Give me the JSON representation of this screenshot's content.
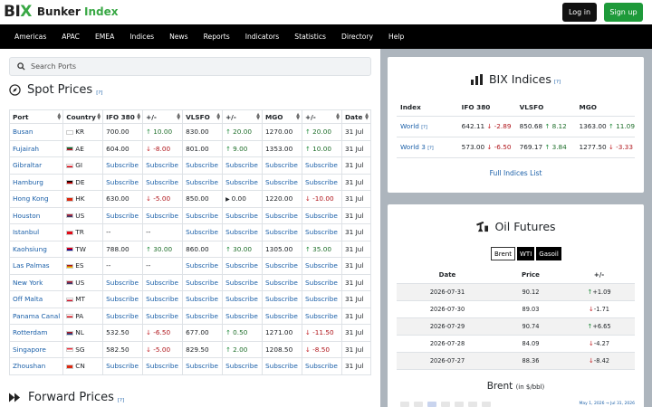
{
  "header": {
    "logo_bi": "BI",
    "logo_x": "X",
    "brand_name": "Bunker",
    "brand_index": "Index",
    "login_label": "Log in",
    "signup_label": "Sign up"
  },
  "nav": [
    "Americas",
    "APAC",
    "EMEA",
    "Indices",
    "News",
    "Reports",
    "Indicators",
    "Statistics",
    "Directory",
    "Help"
  ],
  "search": {
    "placeholder": "Search Ports"
  },
  "spot": {
    "title": "Spot Prices",
    "help": "[?]",
    "columns": [
      "Port",
      "Country",
      "IFO 380",
      "+/-",
      "VLSFO",
      "+/-",
      "MGO",
      "+/-",
      "Date"
    ],
    "rows": [
      {
        "port": "Busan",
        "flag": "kr",
        "country": "KR",
        "ifo": "700.00",
        "ifo_chg": "10.00",
        "ifo_dir": "up",
        "vlsfo": "830.00",
        "vlsfo_chg": "20.00",
        "vlsfo_dir": "up",
        "mgo": "1270.00",
        "mgo_chg": "20.00",
        "mgo_dir": "up",
        "date": "31 Jul"
      },
      {
        "port": "Fujairah",
        "flag": "ae",
        "country": "AE",
        "ifo": "604.00",
        "ifo_chg": "-8.00",
        "ifo_dir": "dn",
        "vlsfo": "801.00",
        "vlsfo_chg": "9.00",
        "vlsfo_dir": "up",
        "mgo": "1353.00",
        "mgo_chg": "10.00",
        "mgo_dir": "up",
        "date": "31 Jul"
      },
      {
        "port": "Gibraltar",
        "flag": "gi",
        "country": "GI",
        "ifo": "Subscribe",
        "ifo_chg": "Subscribe",
        "ifo_dir": "sub",
        "vlsfo": "Subscribe",
        "vlsfo_chg": "Subscribe",
        "vlsfo_dir": "sub",
        "mgo": "Subscribe",
        "mgo_chg": "Subscribe",
        "mgo_dir": "sub",
        "date": "31 Jul"
      },
      {
        "port": "Hamburg",
        "flag": "de",
        "country": "DE",
        "ifo": "Subscribe",
        "ifo_chg": "Subscribe",
        "ifo_dir": "sub",
        "vlsfo": "Subscribe",
        "vlsfo_chg": "Subscribe",
        "vlsfo_dir": "sub",
        "mgo": "Subscribe",
        "mgo_chg": "Subscribe",
        "mgo_dir": "sub",
        "date": "31 Jul"
      },
      {
        "port": "Hong Kong",
        "flag": "hk",
        "country": "HK",
        "ifo": "630.00",
        "ifo_chg": "-5.00",
        "ifo_dir": "dn",
        "vlsfo": "850.00",
        "vlsfo_chg": "0.00",
        "vlsfo_dir": "flat",
        "mgo": "1220.00",
        "mgo_chg": "-10.00",
        "mgo_dir": "dn",
        "date": "31 Jul"
      },
      {
        "port": "Houston",
        "flag": "us",
        "country": "US",
        "ifo": "Subscribe",
        "ifo_chg": "Subscribe",
        "ifo_dir": "sub",
        "vlsfo": "Subscribe",
        "vlsfo_chg": "Subscribe",
        "vlsfo_dir": "sub",
        "mgo": "Subscribe",
        "mgo_chg": "Subscribe",
        "mgo_dir": "sub",
        "date": "31 Jul"
      },
      {
        "port": "Istanbul",
        "flag": "tr",
        "country": "TR",
        "ifo": "--",
        "ifo_chg": "--",
        "ifo_dir": "none",
        "vlsfo": "Subscribe",
        "vlsfo_chg": "Subscribe",
        "vlsfo_dir": "sub",
        "mgo": "Subscribe",
        "mgo_chg": "Subscribe",
        "mgo_dir": "sub",
        "date": "31 Jul"
      },
      {
        "port": "Kaohsiung",
        "flag": "tw",
        "country": "TW",
        "ifo": "788.00",
        "ifo_chg": "30.00",
        "ifo_dir": "up",
        "vlsfo": "860.00",
        "vlsfo_chg": "30.00",
        "vlsfo_dir": "up",
        "mgo": "1305.00",
        "mgo_chg": "35.00",
        "mgo_dir": "up",
        "date": "31 Jul"
      },
      {
        "port": "Las Palmas",
        "flag": "es",
        "country": "ES",
        "ifo": "--",
        "ifo_chg": "--",
        "ifo_dir": "none",
        "vlsfo": "Subscribe",
        "vlsfo_chg": "Subscribe",
        "vlsfo_dir": "sub",
        "mgo": "Subscribe",
        "mgo_chg": "Subscribe",
        "mgo_dir": "sub",
        "date": "31 Jul"
      },
      {
        "port": "New York",
        "flag": "us",
        "country": "US",
        "ifo": "Subscribe",
        "ifo_chg": "Subscribe",
        "ifo_dir": "sub",
        "vlsfo": "Subscribe",
        "vlsfo_chg": "Subscribe",
        "vlsfo_dir": "sub",
        "mgo": "Subscribe",
        "mgo_chg": "Subscribe",
        "mgo_dir": "sub",
        "date": "31 Jul"
      },
      {
        "port": "Off Malta",
        "flag": "mt",
        "country": "MT",
        "ifo": "Subscribe",
        "ifo_chg": "Subscribe",
        "ifo_dir": "sub",
        "vlsfo": "Subscribe",
        "vlsfo_chg": "Subscribe",
        "vlsfo_dir": "sub",
        "mgo": "Subscribe",
        "mgo_chg": "Subscribe",
        "mgo_dir": "sub",
        "date": "31 Jul"
      },
      {
        "port": "Panama Canal",
        "flag": "pa",
        "country": "PA",
        "ifo": "Subscribe",
        "ifo_chg": "Subscribe",
        "ifo_dir": "sub",
        "vlsfo": "Subscribe",
        "vlsfo_chg": "Subscribe",
        "vlsfo_dir": "sub",
        "mgo": "Subscribe",
        "mgo_chg": "Subscribe",
        "mgo_dir": "sub",
        "date": "31 Jul"
      },
      {
        "port": "Rotterdam",
        "flag": "nl",
        "country": "NL",
        "ifo": "532.50",
        "ifo_chg": "-6.50",
        "ifo_dir": "dn",
        "vlsfo": "677.00",
        "vlsfo_chg": "0.50",
        "vlsfo_dir": "up",
        "mgo": "1271.00",
        "mgo_chg": "-11.50",
        "mgo_dir": "dn",
        "date": "31 Jul"
      },
      {
        "port": "Singapore",
        "flag": "sg",
        "country": "SG",
        "ifo": "582.50",
        "ifo_chg": "-5.00",
        "ifo_dir": "dn",
        "vlsfo": "829.50",
        "vlsfo_chg": "2.00",
        "vlsfo_dir": "up",
        "mgo": "1208.50",
        "mgo_chg": "-8.50",
        "mgo_dir": "dn",
        "date": "31 Jul"
      },
      {
        "port": "Zhoushan",
        "flag": "cn",
        "country": "CN",
        "ifo": "Subscribe",
        "ifo_chg": "Subscribe",
        "ifo_dir": "sub",
        "vlsfo": "Subscribe",
        "vlsfo_chg": "Subscribe",
        "vlsfo_dir": "sub",
        "mgo": "Subscribe",
        "mgo_chg": "Subscribe",
        "mgo_dir": "sub",
        "date": "31 Jul"
      }
    ]
  },
  "forward": {
    "title": "Forward Prices",
    "help": "[?]"
  },
  "bix": {
    "title": "BIX Indices",
    "help": "[?]",
    "columns": [
      "Index",
      "IFO 380",
      "VLSFO",
      "MGO"
    ],
    "rows": [
      {
        "name": "World",
        "help": "[?]",
        "ifo": "642.11",
        "ifo_chg": "-2.89",
        "ifo_dir": "dn",
        "vlsfo": "850.68",
        "vlsfo_chg": "8.12",
        "vlsfo_dir": "up",
        "mgo": "1363.00",
        "mgo_chg": "11.09",
        "mgo_dir": "up"
      },
      {
        "name": "World 3",
        "help": "[?]",
        "ifo": "573.00",
        "ifo_chg": "-6.50",
        "ifo_dir": "dn",
        "vlsfo": "769.17",
        "vlsfo_chg": "3.84",
        "vlsfo_dir": "up",
        "mgo": "1277.50",
        "mgo_chg": "-3.33",
        "mgo_dir": "dn"
      }
    ],
    "full_list": "Full Indices List"
  },
  "futures": {
    "title": "Oil Futures",
    "tabs": [
      "Brent",
      "WTI",
      "Gasoil"
    ],
    "active_tab": "Brent",
    "columns": [
      "Date",
      "Price",
      "+/-"
    ],
    "rows": [
      {
        "date": "2026-07-31",
        "price": "90.12",
        "chg": "+1.09",
        "dir": "up"
      },
      {
        "date": "2026-07-30",
        "price": "89.03",
        "chg": "-1.71",
        "dir": "dn"
      },
      {
        "date": "2026-07-29",
        "price": "90.74",
        "chg": "+6.65",
        "dir": "up"
      },
      {
        "date": "2026-07-28",
        "price": "84.09",
        "chg": "-4.27",
        "dir": "dn"
      },
      {
        "date": "2026-07-27",
        "price": "88.36",
        "chg": "-8.42",
        "dir": "dn"
      }
    ],
    "chart_title": "Brent",
    "chart_unit": "(in $/bbl)",
    "date_range": "May 1, 2026 → Jul 31, 2026"
  },
  "colors": {
    "accent_green": "#1e9a3a",
    "link_blue": "#1a5fa8",
    "down_red": "#c11b20"
  }
}
